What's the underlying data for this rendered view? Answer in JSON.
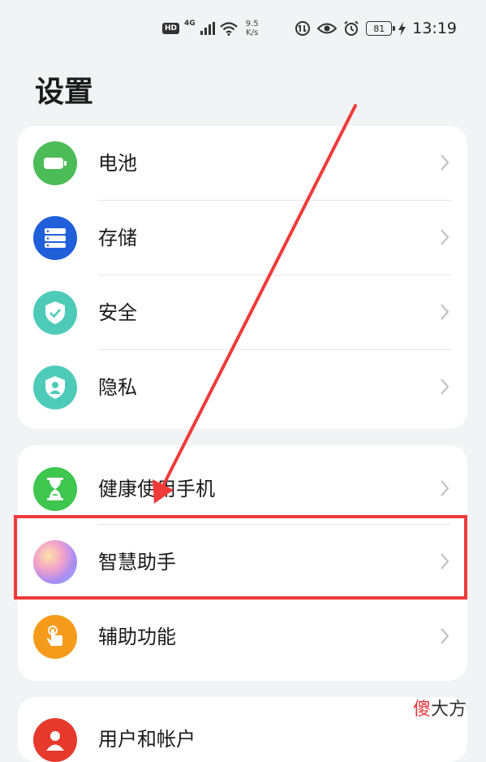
{
  "status_bar": {
    "hd": "HD",
    "network": "4G",
    "speed_value": "9.5",
    "speed_unit": "K/s",
    "battery": "81",
    "time": "13:19"
  },
  "page_title": "设置",
  "groups": [
    {
      "items": [
        {
          "label": "电池",
          "icon": "battery-icon",
          "color": "#4cbc58"
        },
        {
          "label": "存储",
          "icon": "storage-icon",
          "color": "#1f5fd9"
        },
        {
          "label": "安全",
          "icon": "security-shield-icon",
          "color": "#4ecbb8"
        },
        {
          "label": "隐私",
          "icon": "privacy-icon",
          "color": "#4ecbb8"
        }
      ]
    },
    {
      "items": [
        {
          "label": "健康使用手机",
          "icon": "hourglass-icon",
          "color": "#3ec64e"
        },
        {
          "label": "智慧助手",
          "icon": "smart-assistant-icon",
          "color": "gradient"
        },
        {
          "label": "辅助功能",
          "icon": "accessibility-hand-icon",
          "color": "#f59b1c"
        }
      ]
    },
    {
      "items": [
        {
          "label": "用户和帐户",
          "icon": "user-icon",
          "color": "#e53a2c"
        }
      ]
    }
  ],
  "annotation": {
    "highlight_color": "#ef3a3a",
    "highlighted_item": "智慧助手"
  },
  "watermark": {
    "accent": "傻",
    "rest": "大方"
  }
}
